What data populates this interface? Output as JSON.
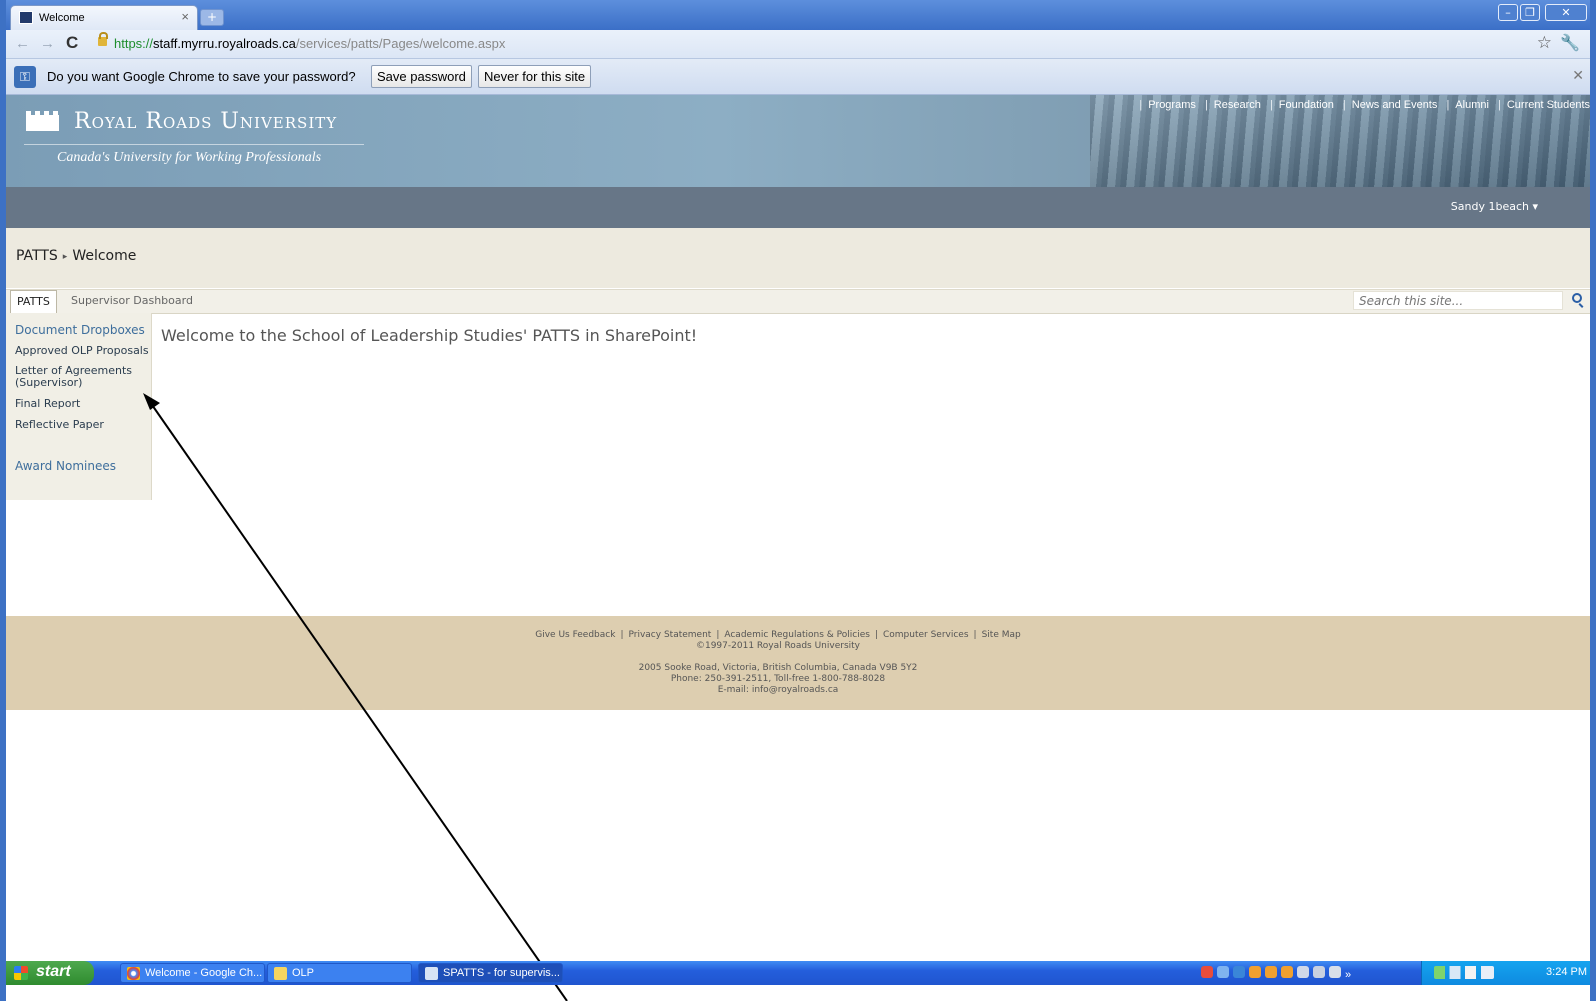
{
  "browser": {
    "tab_title": "Welcome",
    "url_scheme": "https://",
    "url_host": "staff.myrru.royalroads.ca",
    "url_path": "/services/patts/Pages/welcome.aspx"
  },
  "infobar": {
    "message": "Do you want Google Chrome to save your password?",
    "save_label": "Save password",
    "never_label": "Never for this site"
  },
  "banner": {
    "brand": "Royal Roads University",
    "tagline": "Canada's University for Working Professionals",
    "nav": [
      "Programs",
      "Research",
      "Foundation",
      "News and Events",
      "Alumni",
      "Current Students"
    ]
  },
  "user": {
    "name": "Sandy 1beach ▾"
  },
  "page": {
    "breadcrumb_root": "PATTS",
    "breadcrumb_current": "Welcome",
    "welcome_text": "Welcome to the School of Leadership Studies' PATTS in SharePoint!"
  },
  "topnav": {
    "tabs": [
      "PATTS",
      "Supervisor Dashboard"
    ],
    "search_placeholder": "Search this site..."
  },
  "quicklaunch": {
    "heading1": "Document Dropboxes",
    "items": [
      "Approved OLP Proposals",
      "Letter of Agreements (Supervisor)",
      "Final Report",
      "Reflective Paper"
    ],
    "heading2": "Award Nominees"
  },
  "footer": {
    "links": [
      "Give Us Feedback",
      "Privacy Statement",
      "Academic Regulations & Policies",
      "Computer Services",
      "Site Map"
    ],
    "copyright": "©1997-2011 Royal Roads University",
    "address": "2005 Sooke Road, Victoria, British Columbia, Canada V9B 5Y2",
    "phone": "Phone: 250-391-2511, Toll-free 1-800-788-8028",
    "email": "E-mail: info@royalroads.ca"
  },
  "taskbar": {
    "start": "start",
    "buttons": [
      "Welcome - Google Ch...",
      "OLP",
      "SPATTS - for supervis..."
    ],
    "more": "»",
    "time": "3:24 PM"
  },
  "colors": {
    "xp_blue": "#245edc",
    "banner": "#8daec4",
    "footer": "#ddceb0",
    "link": "#3e6e9c"
  }
}
